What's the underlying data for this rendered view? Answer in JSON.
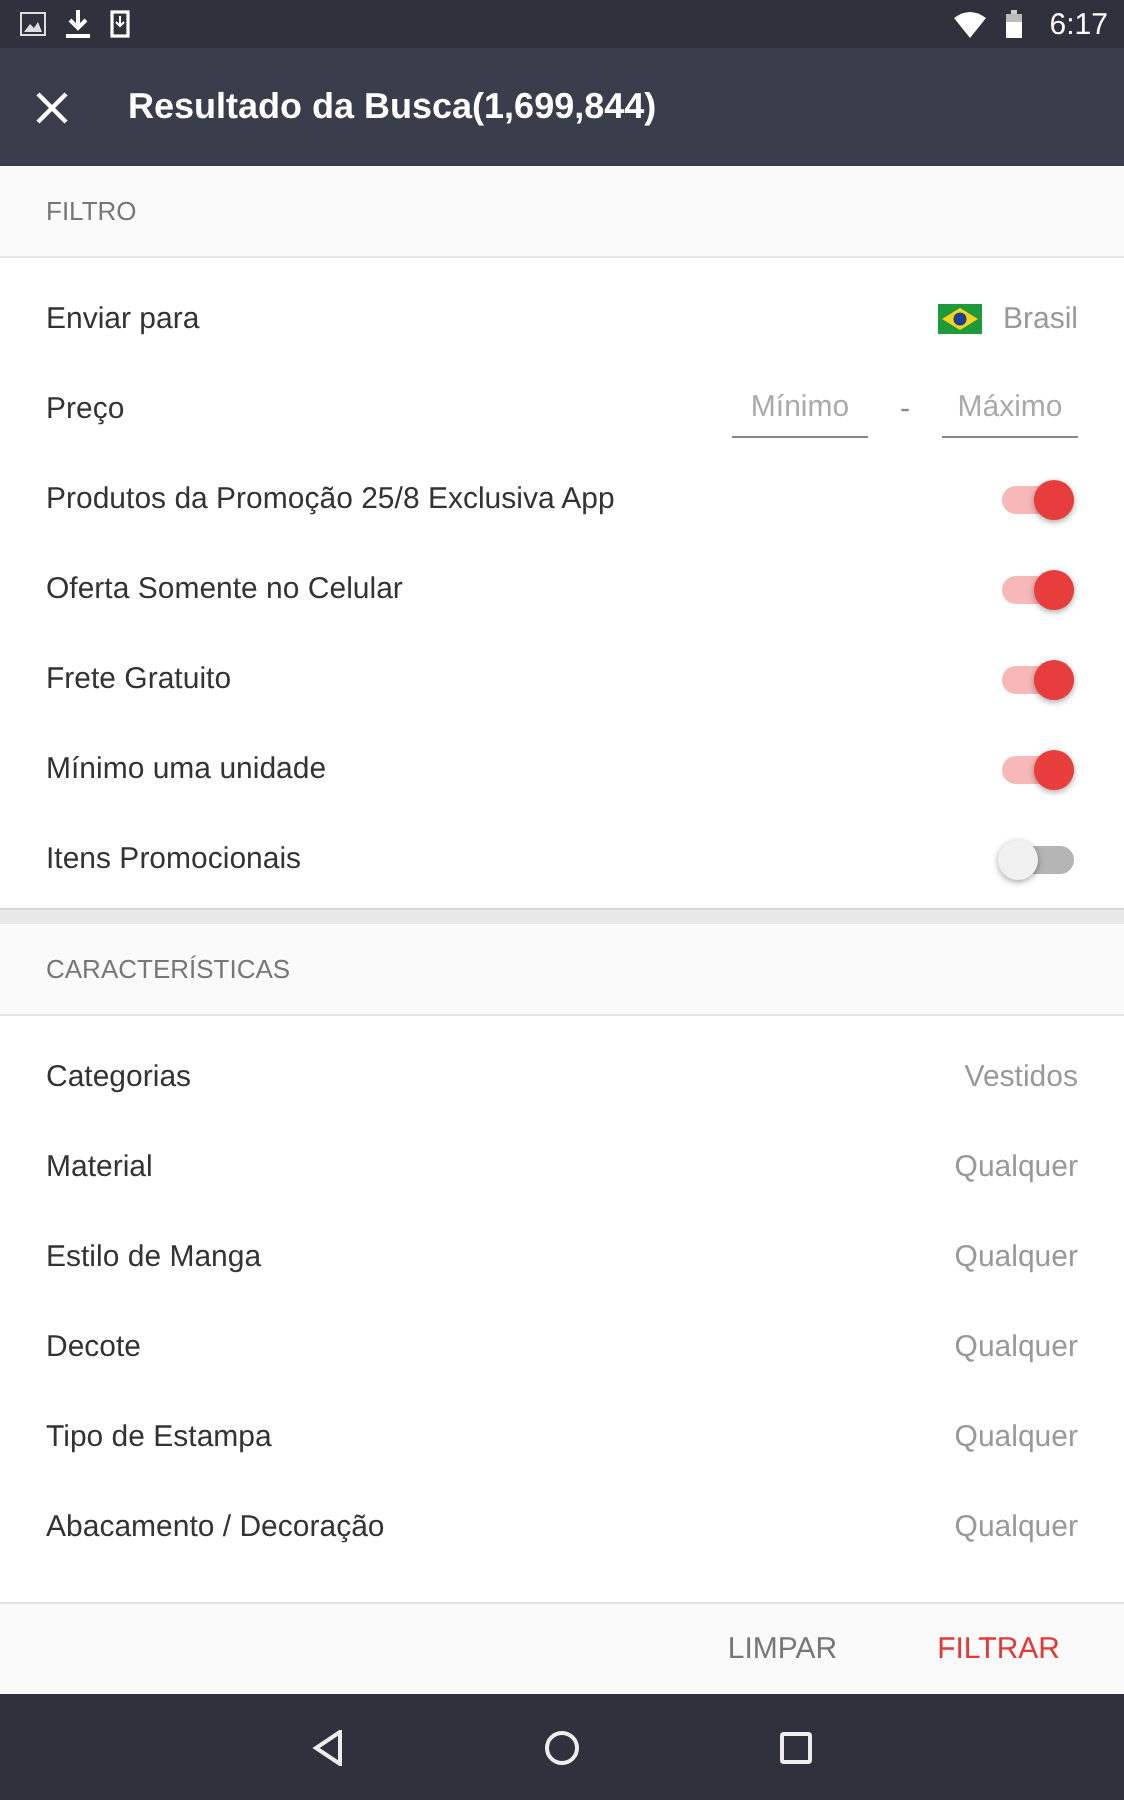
{
  "status_bar": {
    "time": "6:17"
  },
  "app_bar": {
    "title": "Resultado da Busca(1,699,844)"
  },
  "filter": {
    "heading": "FILTRO",
    "rows": [
      {
        "kind": "value",
        "label": "Enviar para",
        "value": "Brasil",
        "flag": true
      },
      {
        "kind": "range",
        "label": "Preço",
        "min_placeholder": "Mínimo",
        "separator": "-",
        "max_placeholder": "Máximo"
      },
      {
        "kind": "switch",
        "label": "Produtos da Promoção 25/8 Exclusiva App",
        "on": true
      },
      {
        "kind": "switch",
        "label": "Oferta Somente no Celular",
        "on": true
      },
      {
        "kind": "switch",
        "label": "Frete Gratuito",
        "on": true
      },
      {
        "kind": "switch",
        "label": "Mínimo uma unidade",
        "on": true
      },
      {
        "kind": "switch",
        "label": "Itens Promocionais",
        "on": false
      }
    ]
  },
  "characteristics": {
    "heading": "CARACTERÍSTICAS",
    "rows": [
      {
        "label": "Categorias",
        "value": "Vestidos"
      },
      {
        "label": "Material",
        "value": "Qualquer"
      },
      {
        "label": "Estilo de Manga",
        "value": "Qualquer"
      },
      {
        "label": "Decote",
        "value": "Qualquer"
      },
      {
        "label": "Tipo de Estampa",
        "value": "Qualquer"
      },
      {
        "label": "Abacamento / Decoração",
        "value": "Qualquer"
      }
    ]
  },
  "footer": {
    "buttons": [
      {
        "label": "LIMPAR",
        "primary": false
      },
      {
        "label": "FILTRAR",
        "primary": true
      }
    ]
  }
}
